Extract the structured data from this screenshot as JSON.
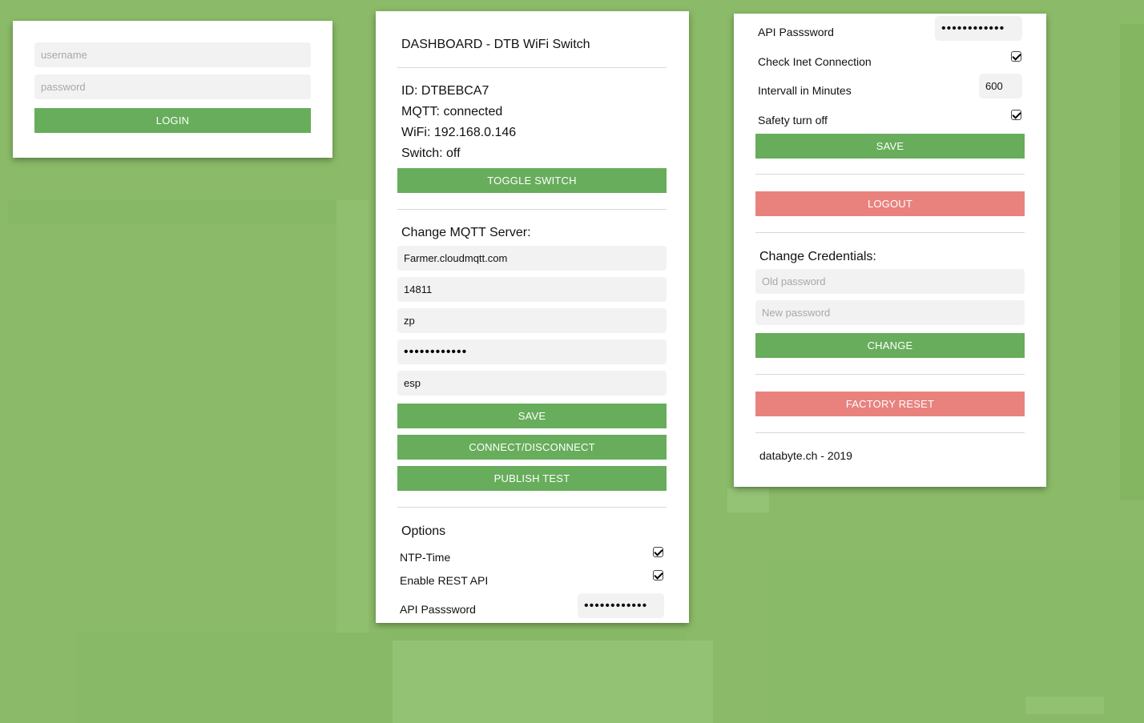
{
  "login": {
    "username_placeholder": "username",
    "password_placeholder": "password",
    "login_label": "LOGIN"
  },
  "dashboard": {
    "title": "DASHBOARD - DTB WiFi Switch",
    "id_line": "ID: DTBEBCA7",
    "mqtt_line": "MQTT: connected",
    "wifi_line": "WiFi: 192.168.0.146",
    "switch_line": "Switch: off",
    "toggle_label": "TOGGLE SWITCH",
    "mqtt_heading": "Change MQTT Server:",
    "mqtt_server": "Farmer.cloudmqtt.com",
    "mqtt_port": "14811",
    "mqtt_user": "zp",
    "mqtt_password": "••••••••••••",
    "mqtt_topic": "esp",
    "save_label": "SAVE",
    "connect_label": "CONNECT/DISCONNECT",
    "publish_label": "PUBLISH TEST",
    "options_heading": "Options",
    "ntp_label": "NTP-Time",
    "rest_label": "Enable REST API",
    "api_password_label": "API Passsword",
    "api_password_value": "••••••••••••"
  },
  "settings": {
    "api_password_label": "API Passsword",
    "api_password_value": "••••••••••••",
    "inet_label": "Check Inet Connection",
    "interval_label": "Intervall in Minutes",
    "interval_value": "600",
    "safety_label": "Safety turn off",
    "save_label": "SAVE",
    "logout_label": "LOGOUT",
    "credentials_heading": "Change Credentials:",
    "old_password_placeholder": "Old password",
    "new_password_placeholder": "New password",
    "change_label": "CHANGE",
    "factory_reset_label": "FACTORY RESET",
    "footer": "databyte.ch - 2019"
  },
  "colors": {
    "background": "#8bbb68",
    "primary_button": "#67ad5b",
    "danger_button": "#e9827d"
  }
}
